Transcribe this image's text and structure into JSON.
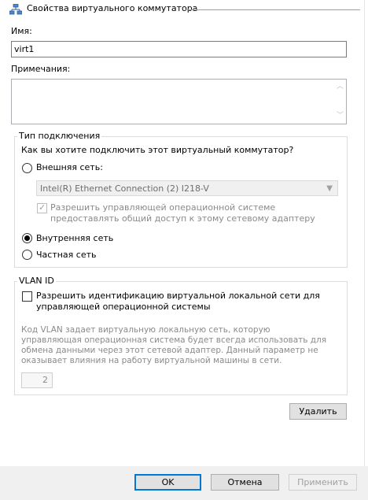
{
  "header": {
    "title": "Свойства виртуального коммутатора"
  },
  "name_field": {
    "label": "Имя:",
    "value": "virt1"
  },
  "notes_field": {
    "label": "Примечания:",
    "value": ""
  },
  "connection_type": {
    "legend": "Тип подключения",
    "question": "Как вы хотите подключить этот виртуальный коммутатор?",
    "external": {
      "label": "Внешняя сеть:",
      "adapter": "Intel(R) Ethernet Connection (2) I218-V",
      "allow_mgmt_label": "Разрешить управляющей операционной системе предоставлять общий доступ к этому сетевому адаптеру"
    },
    "internal": {
      "label": "Внутренняя сеть"
    },
    "private": {
      "label": "Частная сеть"
    },
    "selected": "internal"
  },
  "vlan": {
    "legend": "VLAN ID",
    "enable_label": "Разрешить идентификацию виртуальной локальной сети для управляющей операционной системы",
    "description": "Код VLAN задает виртуальную локальную сеть, которую управляющая операционная система будет всегда использовать для обмена данными через этот сетевой адаптер. Данный параметр не оказывает влияния на работу виртуальной машины в сети.",
    "value": "2"
  },
  "buttons": {
    "remove": "Удалить",
    "ok": "OK",
    "cancel": "Отмена",
    "apply": "Применить"
  }
}
